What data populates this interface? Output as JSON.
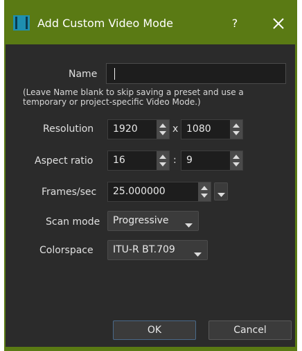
{
  "window": {
    "title": "Add Custom Video Mode",
    "help_label": "?",
    "accent": "#5a7a14"
  },
  "form": {
    "name": {
      "label": "Name",
      "value": ""
    },
    "note": "(Leave Name blank to skip saving a preset and use a temporary or project-specific Video Mode.)",
    "resolution": {
      "label": "Resolution",
      "width": "1920",
      "separator": "x",
      "height": "1080"
    },
    "aspect": {
      "label": "Aspect ratio",
      "num": "16",
      "separator": ":",
      "den": "9"
    },
    "fps": {
      "label": "Frames/sec",
      "value": "25.000000"
    },
    "scan": {
      "label": "Scan mode",
      "value": "Progressive"
    },
    "colorspace": {
      "label": "Colorspace",
      "value": "ITU-R BT.709"
    }
  },
  "buttons": {
    "ok": "OK",
    "cancel": "Cancel"
  },
  "icons": {
    "app": "app-icon",
    "close": "close-icon",
    "spin": "spin-arrows-icon",
    "dropdown": "chevron-down-icon"
  }
}
